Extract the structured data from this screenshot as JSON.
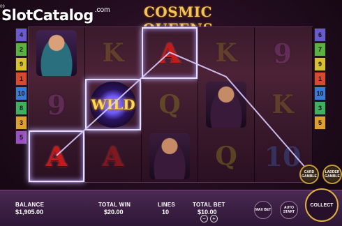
{
  "corner_number": "09",
  "brand": {
    "word_first": "Slot",
    "word_second": "Catalog",
    "suffix": ".com"
  },
  "game_title": "COSMIC QUEENS",
  "reels": [
    [
      "woman-blue",
      "9",
      "A"
    ],
    [
      "K",
      "WILD",
      "A"
    ],
    [
      "A",
      "Q",
      "woman-dark"
    ],
    [
      "K",
      "woman-dark",
      "Q"
    ],
    [
      "9",
      "K",
      "10"
    ]
  ],
  "left_lines": [
    "4",
    "2",
    "9",
    "1",
    "10",
    "8",
    "3",
    "5"
  ],
  "right_lines": [
    "6",
    "7",
    "9",
    "1",
    "10",
    "3",
    "5"
  ],
  "gamble_buttons": [
    {
      "label": "CARD GAMBLE"
    },
    {
      "label": "LADDER GAMBLE"
    }
  ],
  "panel": {
    "balance_label": "BALANCE",
    "balance_value": "$1,905.00",
    "total_win_label": "TOTAL WIN",
    "total_win_value": "$20.00",
    "lines_label": "LINES",
    "lines_value": "10",
    "total_bet_label": "TOTAL BET",
    "total_bet_value": "$10.00",
    "minus": "−",
    "plus": "+",
    "max_bet": "MAX BET",
    "auto_start": "AUTO START",
    "collect": "COLLECT"
  },
  "colors": {
    "title_gold": "#f3c45a",
    "ace_red": "#c41a1a",
    "collect_ring": "#e0b040"
  }
}
